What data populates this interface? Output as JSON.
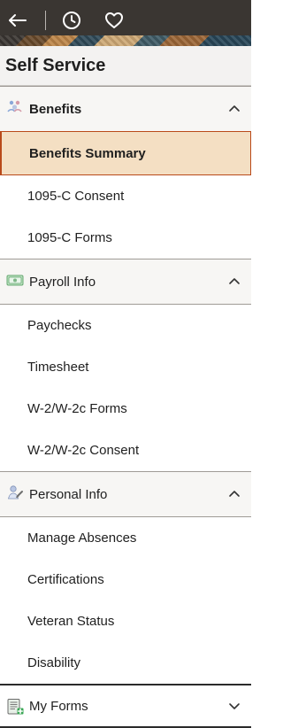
{
  "header": {
    "back_icon": "arrow-left-icon",
    "history_icon": "clock-icon",
    "favorites_icon": "heart-icon"
  },
  "title": "Self Service",
  "sections": [
    {
      "label": "Benefits",
      "expanded": true,
      "items": [
        "Benefits Summary",
        "1095-C Consent",
        "1095-C Forms"
      ],
      "selected_item": "Benefits Summary"
    },
    {
      "label": "Payroll Info",
      "expanded": true,
      "items": [
        "Paychecks",
        "Timesheet",
        "W-2/W-2c Forms",
        "W-2/W-2c Consent"
      ]
    },
    {
      "label": "Personal Info",
      "expanded": true,
      "items": [
        "Manage Absences",
        "Certifications",
        "Veteran Status",
        "Disability"
      ]
    },
    {
      "label": "My Forms",
      "expanded": false,
      "items": []
    }
  ],
  "colors": {
    "header_bg": "#3a3632",
    "selected_bg": "#f4dfc3",
    "selected_border": "#b94a1a",
    "section_bg": "#f7f6f4",
    "divider": "#9f9b96"
  }
}
